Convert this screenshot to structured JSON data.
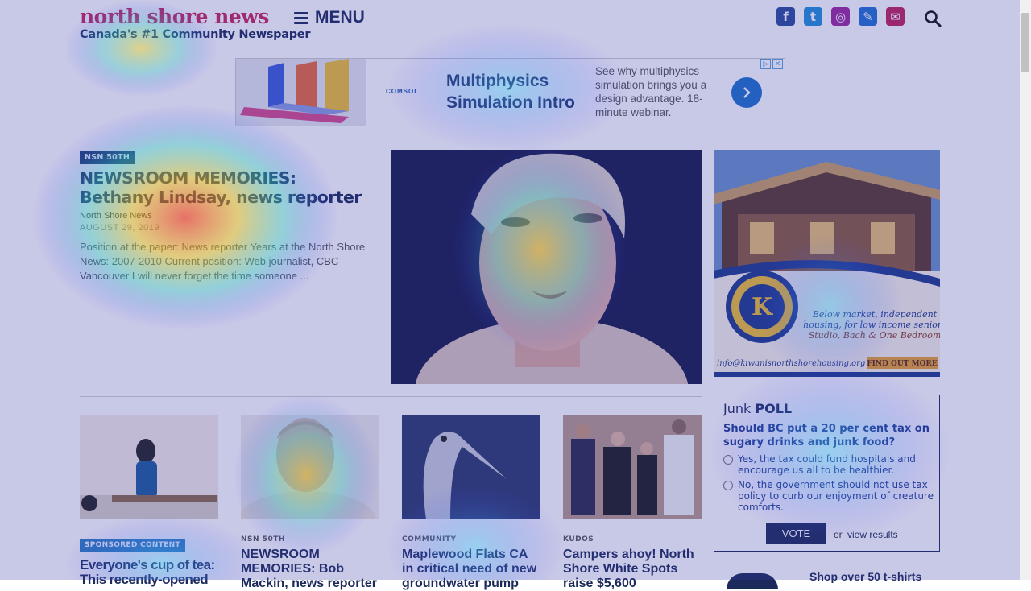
{
  "header": {
    "logo": "north shore news",
    "tagline": "Canada's #1 Community Newspaper",
    "menu_label": "MENU",
    "social": [
      {
        "icon": "facebook-icon",
        "glyph": "f",
        "color": "#2a4a9a"
      },
      {
        "icon": "twitter-icon",
        "glyph": "t",
        "color": "#1f8fd8"
      },
      {
        "icon": "instagram-icon",
        "glyph": "◎",
        "color": "#9b2a9b"
      },
      {
        "icon": "pencil-icon",
        "glyph": "✎",
        "color": "#1f6fd0"
      },
      {
        "icon": "mail-icon",
        "glyph": "✉",
        "color": "#c0205a"
      }
    ]
  },
  "ad": {
    "brand": "COMSOL",
    "title": "Multiphysics Simulation Intro",
    "description": "See why multiphysics simulation brings you a design advantage. 18-minute webinar."
  },
  "feature": {
    "badge": "NSN 50TH",
    "title": "NEWSROOM MEMORIES: Bethany Lindsay, news reporter",
    "author": "North Shore News",
    "date": "AUGUST 29, 2019",
    "excerpt": "Position at the paper: News reporter Years at the North Shore News: 2007-2010 Current position: Web journalist, CBC Vancouver I will never forget the time someone ..."
  },
  "side_ad": {
    "text": "Below market, independent housing, for low income seniors Studio, Bach & One Bedroom",
    "email": "info@kiwanisnorthshorehousing.org",
    "cta": "FIND OUT MORE",
    "seal": "KIWANIS INTERNATIONAL"
  },
  "cards": [
    {
      "badge": "SPONSORED CONTENT",
      "title": "Everyone's cup of tea: This recently-opened"
    },
    {
      "category": "NSN 50TH",
      "title": "NEWSROOM MEMORIES: Bob Mackin, news reporter"
    },
    {
      "category": "COMMUNITY",
      "title": "Maplewood Flats CA in critical need of new groundwater pump"
    },
    {
      "category": "KUDOS",
      "title": "Campers ahoy! North Shore White Spots raise $5,600"
    }
  ],
  "poll": {
    "head_light": "Junk",
    "head_bold": "POLL",
    "question": "Should BC put a 20 per cent tax on sugary drinks and junk food?",
    "options": [
      "Yes, the tax could fund hospitals and encourage us all to be healthier.",
      "No, the government should not use tax policy to curb our enjoyment of creature comforts."
    ],
    "vote_label": "VOTE",
    "or_label": "or",
    "results_label": "view results"
  },
  "shop_text": "Shop over 50 t-shirts"
}
